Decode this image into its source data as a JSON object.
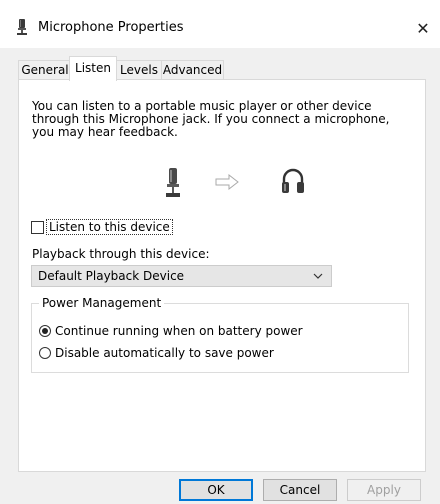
{
  "window": {
    "title": "Microphone Properties",
    "close_glyph": "✕"
  },
  "tabs": [
    {
      "label": "General",
      "active": false
    },
    {
      "label": "Listen",
      "active": true
    },
    {
      "label": "Levels",
      "active": false
    },
    {
      "label": "Advanced",
      "active": false
    }
  ],
  "listen": {
    "description": "You can listen to a portable music player or other device through this Microphone jack.  If you connect a microphone, you may hear feedback.",
    "listen_checkbox_label": "Listen to this device",
    "listen_checked": false,
    "playback_label": "Playback through this device:",
    "playback_selected": "Default Playback Device"
  },
  "power": {
    "title": "Power Management",
    "options": [
      {
        "label": "Continue running when on battery power",
        "checked": true
      },
      {
        "label": "Disable automatically to save power",
        "checked": false
      }
    ]
  },
  "buttons": {
    "ok": "OK",
    "cancel": "Cancel",
    "apply": "Apply"
  },
  "icons": {
    "source": "microphone-icon",
    "arrow": "arrow-right-icon",
    "target": "headphones-icon"
  }
}
